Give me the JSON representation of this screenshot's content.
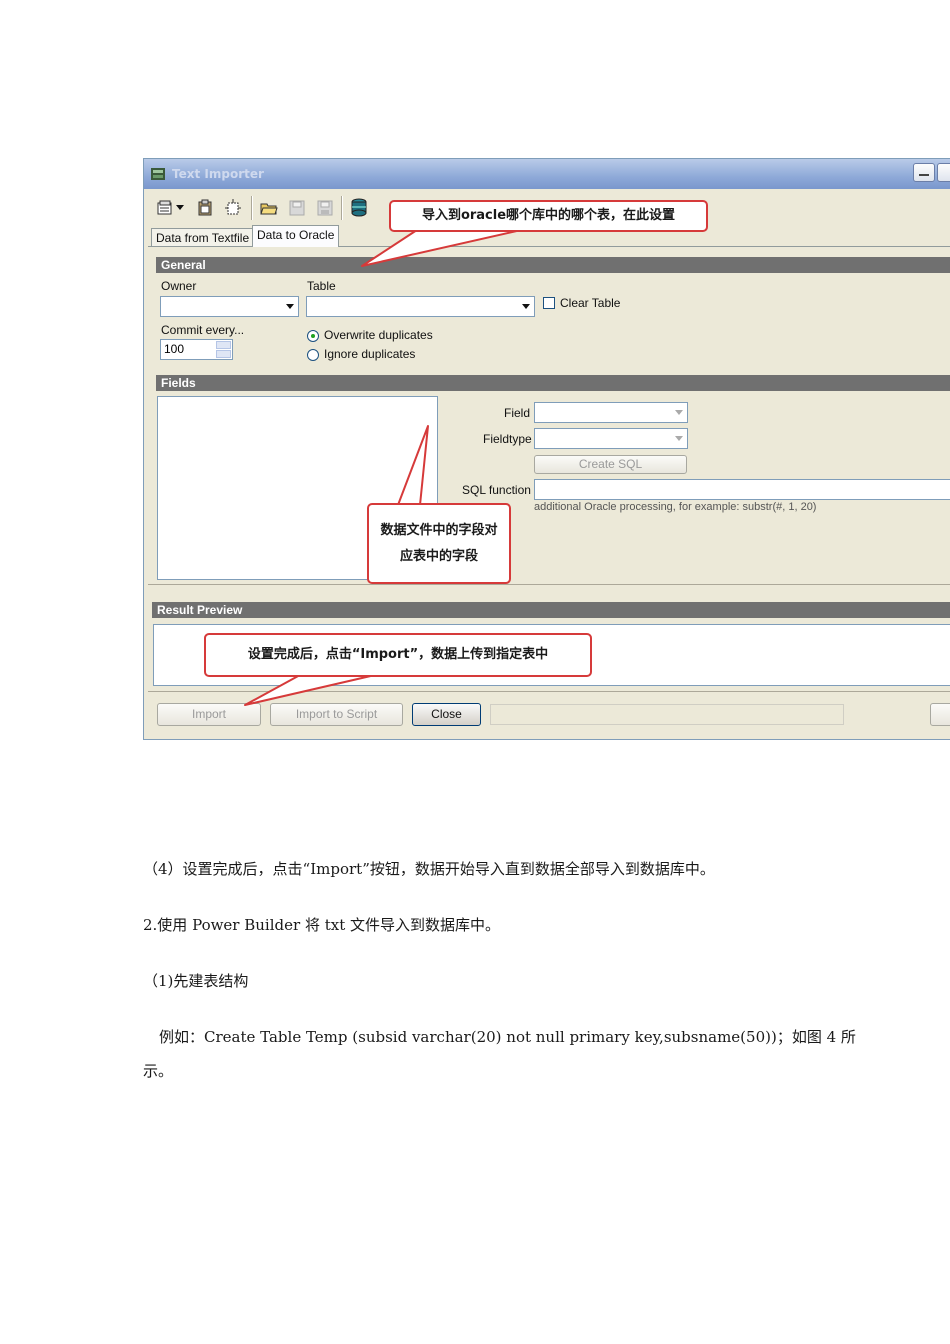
{
  "window": {
    "title": "Text Importer",
    "tabs": [
      "Data from Textfile",
      "Data to Oracle"
    ],
    "active_tab": "Data to Oracle",
    "toolbar_icons": [
      "open-script-icon",
      "dropdown-arrow-icon",
      "clipboard-icon",
      "settings-icon",
      "open-folder-icon",
      "save-icon",
      "save-as-icon",
      "database-icon"
    ]
  },
  "general": {
    "header": "General",
    "owner_label": "Owner",
    "owner_value": "",
    "table_label": "Table",
    "table_value": "",
    "clear_table_label": "Clear Table",
    "clear_table_checked": false,
    "commit_label": "Commit every...",
    "commit_value": "100",
    "overwrite_label": "Overwrite duplicates",
    "ignore_label": "Ignore duplicates",
    "duplicates_mode": "overwrite"
  },
  "fields": {
    "header": "Fields",
    "field_label": "Field",
    "fieldtype_label": "Fieldtype",
    "create_sql_label": "Create SQL",
    "sql_function_label": "SQL function",
    "sql_function_value": "",
    "hint": "additional Oracle processing, for example: substr(#, 1, 20)"
  },
  "result": {
    "header": "Result Preview"
  },
  "buttons": {
    "import": "Import",
    "import_script": "Import to Script",
    "close": "Close"
  },
  "callouts": {
    "target": "导入到oracle哪个库中的哪个表，在此设置",
    "fields_line1": "数据文件中的字段对",
    "fields_line2": "应表中的字段",
    "import": "设置完成后，点击“Import”，数据上传到指定表中"
  },
  "colors": {
    "callout_border": "#d63a3a",
    "section_header": "#707070",
    "titlebar": "#8ea9d8"
  },
  "doc": {
    "p1": "（4）设置完成后，点击“Import”按钮，数据开始导入直到数据全部导入到数据库中。",
    "p2": "2.使用 Power Builder  将 txt 文件导入到数据库中。",
    "p3": "（1)先建表结构",
    "p4": "例如：Create Table Temp (subsid varchar(20) not null primary key,subsname(50))；如图 4 所",
    "p5": "示。"
  }
}
